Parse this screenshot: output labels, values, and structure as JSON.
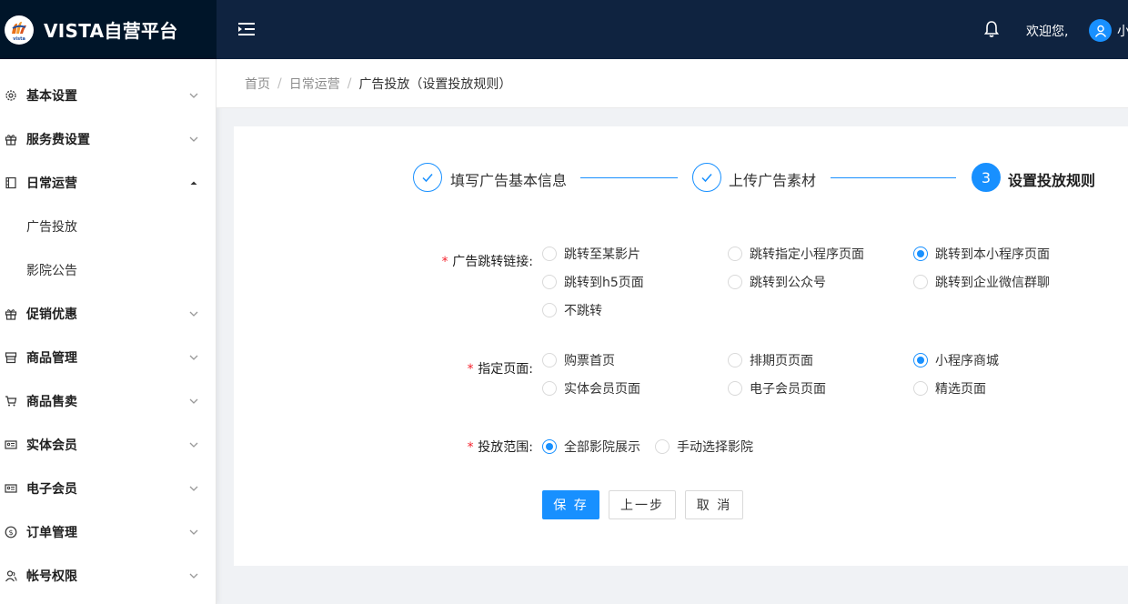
{
  "app": {
    "title": "VISTA自营平台",
    "logo_text": "vista"
  },
  "header": {
    "welcome": "欢迎您,",
    "username": "小"
  },
  "sidebar": {
    "items": [
      {
        "label": "基本设置",
        "icon": "gear-icon",
        "expanded": false
      },
      {
        "label": "服务费设置",
        "icon": "gift-icon",
        "expanded": false
      },
      {
        "label": "日常运营",
        "icon": "film-icon",
        "expanded": true,
        "children": [
          {
            "label": "广告投放"
          },
          {
            "label": "影院公告"
          }
        ]
      },
      {
        "label": "促销优惠",
        "icon": "gift-icon",
        "expanded": false
      },
      {
        "label": "商品管理",
        "icon": "store-icon",
        "expanded": false
      },
      {
        "label": "商品售卖",
        "icon": "cart-icon",
        "expanded": false
      },
      {
        "label": "实体会员",
        "icon": "member-card-icon",
        "expanded": false
      },
      {
        "label": "电子会员",
        "icon": "member-card-icon",
        "expanded": false
      },
      {
        "label": "订单管理",
        "icon": "dollar-icon",
        "expanded": false
      },
      {
        "label": "帐号权限",
        "icon": "users-icon",
        "expanded": false
      }
    ]
  },
  "breadcrumb": {
    "items": [
      "首页",
      "日常运营"
    ],
    "current": "广告投放（设置投放规则）"
  },
  "steps": [
    {
      "title": "填写广告基本信息",
      "status": "finished"
    },
    {
      "title": "上传广告素材",
      "status": "finished"
    },
    {
      "title": "设置投放规则",
      "status": "active",
      "number": "3"
    }
  ],
  "form": {
    "jump_link": {
      "label": "广告跳转链接:",
      "options": [
        "跳转至某影片",
        "跳转指定小程序页面",
        "跳转到本小程序页面",
        "跳转到h5页面",
        "跳转到公众号",
        "跳转到企业微信群聊",
        "不跳转"
      ],
      "selected": "跳转到本小程序页面"
    },
    "target_page": {
      "label": "指定页面:",
      "options": [
        "购票首页",
        "排期页页面",
        "小程序商城",
        "实体会员页面",
        "电子会员页面",
        "精选页面"
      ],
      "selected": "小程序商城"
    },
    "scope": {
      "label": "投放范围:",
      "options": [
        "全部影院展示",
        "手动选择影院"
      ],
      "selected": "全部影院展示"
    },
    "required_mark": "*"
  },
  "buttons": {
    "save": "保 存",
    "prev": "上一步",
    "cancel": "取 消"
  },
  "colors": {
    "header_bg": "#0f2340",
    "logo_bg": "#001529",
    "primary": "#1890ff",
    "required": "#f5222d"
  }
}
